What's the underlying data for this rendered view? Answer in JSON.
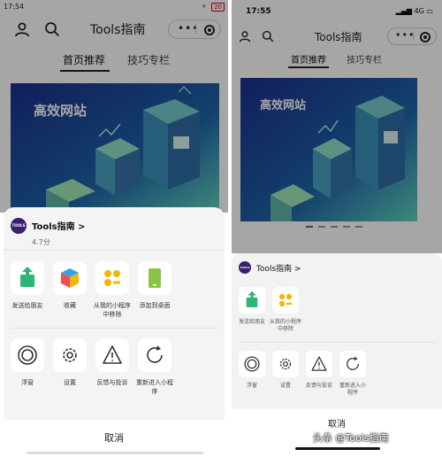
{
  "left_phone": {
    "status_bar": {
      "time": "17:54",
      "battery": "20"
    },
    "nav": {
      "title": "Tools指南"
    },
    "tabs": [
      {
        "label": "首页推荐"
      },
      {
        "label": "技巧专栏"
      }
    ],
    "banner": {
      "text": "高效网站"
    },
    "sheet": {
      "app_name": "Tools指南 >",
      "rating": "4.7分",
      "logo_text": "TOOLS",
      "row1": [
        {
          "label": "发送给朋友",
          "icon": "share-icon"
        },
        {
          "label": "收藏",
          "icon": "cube-icon"
        },
        {
          "label": "从我的小程序中移除",
          "icon": "remove-apps-icon"
        },
        {
          "label": "添加到桌面",
          "icon": "add-to-desktop-icon"
        }
      ],
      "row2": [
        {
          "label": "浮窗",
          "icon": "float-window-icon"
        },
        {
          "label": "设置",
          "icon": "gear-icon"
        },
        {
          "label": "反馈与投诉",
          "icon": "warning-icon"
        },
        {
          "label": "重新进入小程序",
          "icon": "reload-icon"
        }
      ],
      "cancel": "取消"
    }
  },
  "right_phone": {
    "status_bar": {
      "time": "17:55",
      "network": "4G"
    },
    "nav": {
      "title": "Tools指南"
    },
    "tabs": [
      {
        "label": "首页推荐"
      },
      {
        "label": "技巧专栏"
      }
    ],
    "banner": {
      "text": "高效网站"
    },
    "sheet": {
      "app_name": "Tools指南 >",
      "logo_text": "TOOLS",
      "row1": [
        {
          "label": "发送给朋友",
          "icon": "share-icon"
        },
        {
          "label": "从我的小程序中移除",
          "icon": "remove-apps-icon"
        }
      ],
      "row2": [
        {
          "label": "浮窗",
          "icon": "float-window-icon"
        },
        {
          "label": "设置",
          "icon": "gear-icon"
        },
        {
          "label": "反馈与投诉",
          "icon": "warning-icon"
        },
        {
          "label": "重新进入小程序",
          "icon": "reload-icon"
        }
      ],
      "cancel": "取消"
    }
  },
  "watermark": "头条 @Tools指南",
  "colors": {
    "share_green": "#2bb673",
    "orange_yellow": "#f2b705",
    "desktop_green": "#8bc34a",
    "banner_blue": "#1e3a8a",
    "banner_teal": "#2aa6a6",
    "logo_purple": "#3b1e6e"
  }
}
